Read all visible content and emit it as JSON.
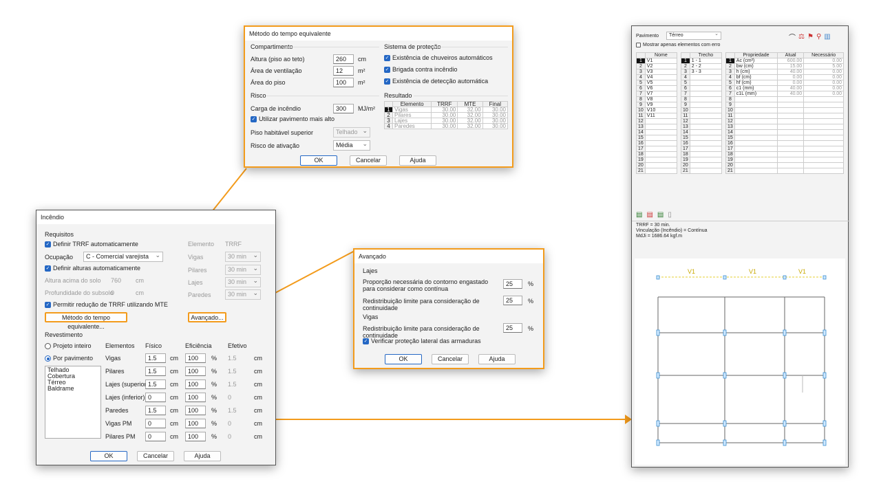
{
  "metodo": {
    "title": "Método do tempo equivalente",
    "compartimento": "Compartimento",
    "altura_label": "Altura (piso ao teto)",
    "altura_val": "260",
    "altura_unit": "cm",
    "area_vent_label": "Área de ventilação",
    "area_vent_val": "12",
    "area_vent_unit": "m²",
    "area_piso_label": "Área do piso",
    "area_piso_val": "100",
    "area_piso_unit": "m²",
    "risco": "Risco",
    "carga_label": "Carga de incêndio",
    "carga_val": "300",
    "carga_unit": "MJ/m²",
    "utilizar": "Utilizar pavimento mais alto",
    "piso_label": "Piso habitável superior",
    "piso_val": "Telhado",
    "risco_at_label": "Risco de ativação",
    "risco_at_val": "Média",
    "sistema": "Sistema de proteção",
    "chuveiros": "Existência de chuveiros automáticos",
    "brigada": "Brigada contra incêndio",
    "deteccao": "Existência de detecção automática",
    "resultado": "Resultado",
    "res_headers": [
      "Elemento",
      "TRRF",
      "MTE",
      "Final"
    ],
    "res_rows": [
      [
        "1",
        "Vigas",
        "30.00",
        "32.00",
        "30.00"
      ],
      [
        "2",
        "Pilares",
        "30.00",
        "32.00",
        "30.00"
      ],
      [
        "3",
        "Lajes",
        "30.00",
        "32.00",
        "30.00"
      ],
      [
        "4",
        "Paredes",
        "30.00",
        "32.00",
        "30.00"
      ]
    ],
    "ok": "OK",
    "cancelar": "Cancelar",
    "ajuda": "Ajuda"
  },
  "incendio": {
    "title": "Incêndio",
    "requisitos": "Requisitos",
    "definir_trrf": "Definir TRRF automaticamente",
    "ocupacao_label": "Ocupação",
    "ocupacao_val": "C - Comercial varejista",
    "definir_alturas": "Definir alturas automaticamente",
    "altura_solo_label": "Altura acima do solo",
    "altura_solo_val": "760",
    "altura_solo_unit": "cm",
    "prof_label": "Profundidade do subsolo",
    "prof_val": "0",
    "prof_unit": "cm",
    "permitir": "Permitir redução de TRRF utilizando MTE",
    "metodo_btn": "Método do tempo equivalente...",
    "avancado_btn": "Avançado...",
    "elem_header": "Elemento",
    "trrf_header": "TRRF",
    "trrf_rows": [
      {
        "el": "Vigas",
        "val": "30 min"
      },
      {
        "el": "Pilares",
        "val": "30 min"
      },
      {
        "el": "Lajes",
        "val": "30 min"
      },
      {
        "el": "Paredes",
        "val": "30 min"
      }
    ],
    "revestimento": "Revestimento",
    "projeto_inteiro": "Projeto inteiro",
    "por_pavimento": "Por pavimento",
    "pavimentos": [
      "Telhado",
      "Cobertura",
      "Térreo",
      "Baldrame"
    ],
    "col_elementos": "Elementos",
    "col_fisico": "Físico",
    "col_eficiencia": "Eficiência",
    "col_efetivo": "Efetivo",
    "rev_rows": [
      {
        "el": "Vigas",
        "fis": "1.5",
        "efi": "100",
        "efe": "1.5"
      },
      {
        "el": "Pilares",
        "fis": "1.5",
        "efi": "100",
        "efe": "1.5"
      },
      {
        "el": "Lajes (superior)",
        "fis": "1.5",
        "efi": "100",
        "efe": "1.5"
      },
      {
        "el": "Lajes (inferior)",
        "fis": "0",
        "efi": "100",
        "efe": "0"
      },
      {
        "el": "Paredes",
        "fis": "1.5",
        "efi": "100",
        "efe": "1.5"
      },
      {
        "el": "Vigas PM",
        "fis": "0",
        "efi": "100",
        "efe": "0"
      },
      {
        "el": "Pilares PM",
        "fis": "0",
        "efi": "100",
        "efe": "0"
      }
    ],
    "cm": "cm",
    "pct": "%",
    "ok": "OK",
    "cancelar": "Cancelar",
    "ajuda": "Ajuda"
  },
  "avancado": {
    "title": "Avançado",
    "lajes": "Lajes",
    "prop_label": "Proporção necessária do contorno engastado para considerar como contínua",
    "prop_val": "25",
    "redist_label": "Redistribuição limite para consideração de continuidade",
    "redist_val": "25",
    "vigas": "Vigas",
    "redist2_label": "Redistribuição limite para consideração de continuidade",
    "redist2_val": "25",
    "verificar": "Verificar proteção lateral das armaduras",
    "pct": "%",
    "ok": "OK",
    "cancelar": "Cancelar",
    "ajuda": "Ajuda"
  },
  "painel": {
    "pavimento_label": "Pavimento",
    "pavimento_val": "Térreo",
    "mostrar": "Mostrar apenas elementos com erro",
    "nome_header": "Nome",
    "trecho_header": "Trecho",
    "prop_header": "Propriedade",
    "atual_header": "Atual",
    "nec_header": "Necessário",
    "nomes": [
      "V1",
      "V2",
      "V3",
      "V4",
      "V5",
      "V6",
      "V7",
      "V8",
      "V9",
      "V10",
      "V11",
      "",
      "",
      "",
      "",
      "",
      "",
      "",
      "",
      "",
      ""
    ],
    "trechos": [
      "1 - 1",
      "2 - 2",
      "3 - 3",
      "",
      "",
      "",
      "",
      "",
      "",
      "",
      "",
      "",
      "",
      "",
      "",
      "",
      "",
      "",
      "",
      "",
      ""
    ],
    "props": [
      {
        "p": "Ac (cm²)",
        "a": "600.00",
        "n": "0.00"
      },
      {
        "p": "bw (cm)",
        "a": "15.00",
        "n": "5.00"
      },
      {
        "p": "h (cm)",
        "a": "40.00",
        "n": "0.00"
      },
      {
        "p": "bf (cm)",
        "a": "0.00",
        "n": "0.00"
      },
      {
        "p": "hf (cm)",
        "a": "0.00",
        "n": "0.00"
      },
      {
        "p": "c1 (mm)",
        "a": "40.00",
        "n": "0.00"
      },
      {
        "p": "c1L (mm)",
        "a": "40.00",
        "n": "0.00"
      }
    ],
    "info1": "TRRF = 30 min.",
    "info2": "Vinculação (Incêndio) = Contínua",
    "info3": "MdJi = 1686.64 kgf.m",
    "beam_labels": [
      "V1",
      "V1",
      "V1"
    ]
  }
}
